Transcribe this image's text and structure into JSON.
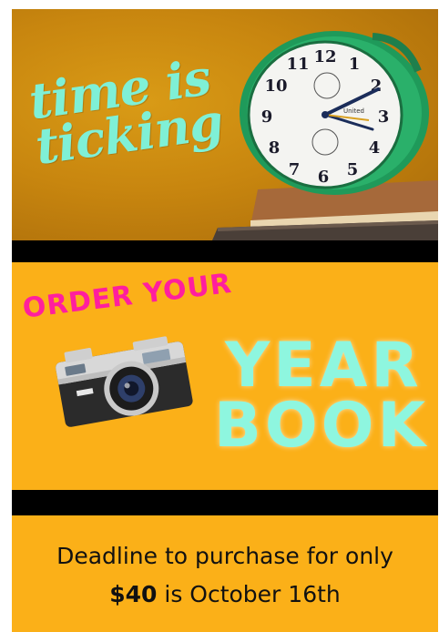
{
  "hero": {
    "headline_line1": "time is",
    "headline_line2": "ticking",
    "clock_icon": "alarm-clock-icon",
    "clock_numbers": [
      "12",
      "1",
      "2",
      "3",
      "4",
      "5",
      "6",
      "7",
      "8",
      "9",
      "10",
      "11"
    ],
    "clock_brand": "United",
    "accent_color": "#7ff0d6"
  },
  "promo": {
    "order_label": "ORDER YOUR",
    "title_line1": "YEAR",
    "title_line2": "BOOK",
    "camera_icon": "camera-icon",
    "order_color": "#ff1f9e",
    "title_color": "#8ef6df",
    "background_color": "#fbb018"
  },
  "footer": {
    "line1": "Deadline to purchase for only",
    "price": "$40",
    "line2_rest": " is October 16th"
  }
}
